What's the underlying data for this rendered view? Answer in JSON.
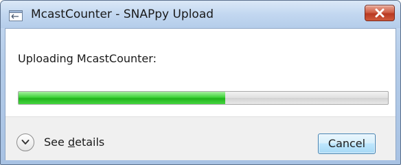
{
  "window": {
    "title": "McastCounter - SNAPpy Upload"
  },
  "dialog": {
    "message": "Uploading McastCounter:",
    "progress_fraction": 0.56,
    "details_label_prefix": "See ",
    "details_label_accel": "d",
    "details_label_suffix": "etails",
    "cancel_label": "Cancel"
  },
  "icons": {
    "app": "window-app-icon",
    "close": "close-icon",
    "expand": "chevron-down-icon"
  },
  "colors": {
    "progress_green": "#20b31b",
    "close_red": "#c8452b"
  }
}
